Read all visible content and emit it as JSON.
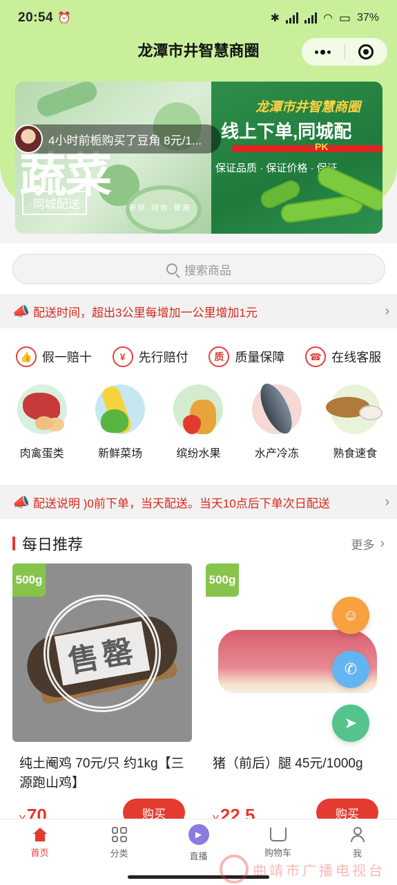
{
  "status_bar": {
    "time": "20:54",
    "battery": "37%"
  },
  "nav": {
    "title": "龙潭市井智慧商圈"
  },
  "banner": {
    "left_big_word": "蔬菜",
    "left_tag": "·同城配送",
    "left_tiny_text": "新鲜·绿色·健康",
    "right_brand": "龙潭市井智慧商圈",
    "right_slogan": "线上下单,同城配",
    "right_pk": "PK",
    "right_guarantee": "保证品质 · 保证价格 · 保证"
  },
  "ticker": {
    "text": "4小时前栀购买了豆角 8元/1..."
  },
  "search": {
    "placeholder": "搜索商品"
  },
  "notice1": {
    "text": "配送时间，超出3公里每增加一公里增加1元"
  },
  "guarantees": [
    {
      "label": "假一赔十",
      "icon": "👍"
    },
    {
      "label": "先行赔付",
      "icon": "¥"
    },
    {
      "label": "质量保障",
      "icon": "质"
    },
    {
      "label": "在线客服",
      "icon": "☎"
    }
  ],
  "categories": [
    {
      "label": "肉禽蛋类"
    },
    {
      "label": "新鲜菜场"
    },
    {
      "label": "缤纷水果"
    },
    {
      "label": "水产冷冻"
    },
    {
      "label": "熟食速食"
    }
  ],
  "notice2": {
    "text": "配送说明 )0前下单，当天配送。当天10点后下单次日配送"
  },
  "section": {
    "title": "每日推荐",
    "more": "更多"
  },
  "products": [
    {
      "weight": "500g",
      "title": "纯土阉鸡 70元/只 约1kg【三源跑山鸡】",
      "price_symbol": "¥",
      "price": "70",
      "buy": "购买",
      "soldout": "售罄"
    },
    {
      "weight": "500g",
      "title": "猪（前后）腿 45元/1000g",
      "price_symbol": "¥",
      "price": "22.5",
      "buy": "购买"
    }
  ],
  "tabs": [
    {
      "label": "首页",
      "icon": "home-icon",
      "active": true
    },
    {
      "label": "分类",
      "icon": "category-icon"
    },
    {
      "label": "直播",
      "icon": "live-icon"
    },
    {
      "label": "购物车",
      "icon": "cart-icon"
    },
    {
      "label": "我",
      "icon": "user-icon"
    }
  ],
  "watermark": {
    "text": "曲靖市广播电视台"
  },
  "colors": {
    "accent": "#e53a2f",
    "header_green": "#c9ef9b",
    "weight_tag": "#87c44a"
  }
}
